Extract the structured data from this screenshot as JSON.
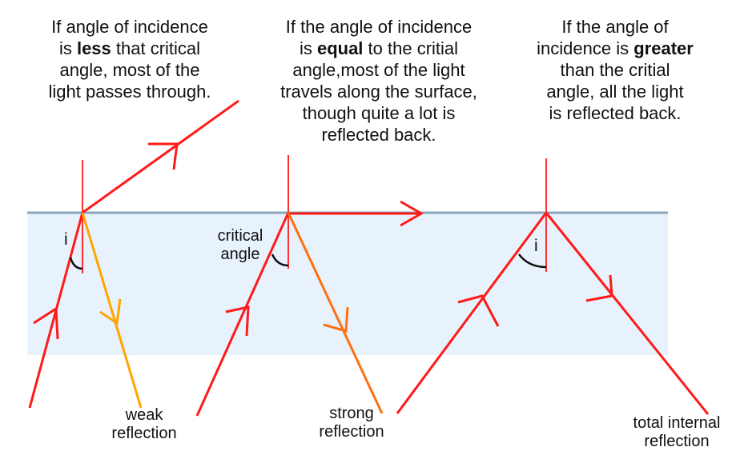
{
  "captions": {
    "less": {
      "line1": "If angle of incidence",
      "line2_pre": "is ",
      "line2_bold": "less",
      "line2_post": " that critical",
      "line3": "angle, most of the",
      "line4": "light passes through."
    },
    "equal": {
      "line1": "If the angle of incidence",
      "line2_pre": "is ",
      "line2_bold": "equal",
      "line2_post": " to the critial",
      "line3": "angle,most of the light",
      "line4": "travels along the surface,",
      "line5": "though quite a lot is",
      "line6": "reflected back."
    },
    "greater": {
      "line1": "If the angle of",
      "line2_pre": "incidence is ",
      "line2_bold": "greater",
      "line3": "than the critial",
      "line4": "angle, all the light",
      "line5": "is reflected back."
    }
  },
  "labels": {
    "weak": {
      "line1": "weak",
      "line2": "reflection"
    },
    "critical": {
      "line1": "critical",
      "line2": "angle"
    },
    "strong": {
      "line1": "strong",
      "line2": "reflection"
    },
    "total": {
      "line1": "total internal",
      "line2": "reflection"
    }
  },
  "symbols": {
    "angle_i_left": "i",
    "angle_i_right": "i"
  },
  "colors": {
    "medium_fill": "#e8f2fc",
    "surface_line": "#8aa4bc",
    "incident_ray": "#ff1a1a",
    "reflected_ray": "#ff8c00",
    "weak_reflected_ray": "#ffa500",
    "normal_line": "#ff3030",
    "angle_arc": "#111111"
  }
}
